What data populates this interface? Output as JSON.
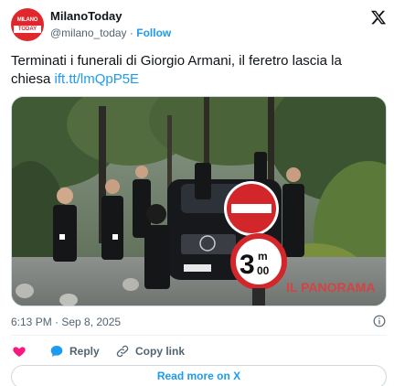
{
  "header": {
    "avatar_line1": "MILANO",
    "avatar_line2": "TODAY",
    "display_name": "MilanoToday",
    "handle": "@milano_today",
    "separator": "·",
    "follow_label": "Follow"
  },
  "tweet": {
    "text": "Terminati i funerali di Giorgio Armani, il feretro lascia la chiesa ",
    "link": "ift.tt/lmQpP5E"
  },
  "media": {
    "sign_number": "3",
    "sign_unit_top": "m",
    "sign_unit_bottom": "00",
    "watermark": "IL PANORAMA"
  },
  "meta": {
    "timestamp": "6:13 PM · Sep 8, 2025"
  },
  "actions": {
    "reply_label": "Reply",
    "copy_label": "Copy link"
  },
  "footer": {
    "read_more_label": "Read more on X"
  },
  "colors": {
    "accent": "#1d9bf0",
    "heart": "#f91880",
    "brand_red": "#e0272c"
  }
}
